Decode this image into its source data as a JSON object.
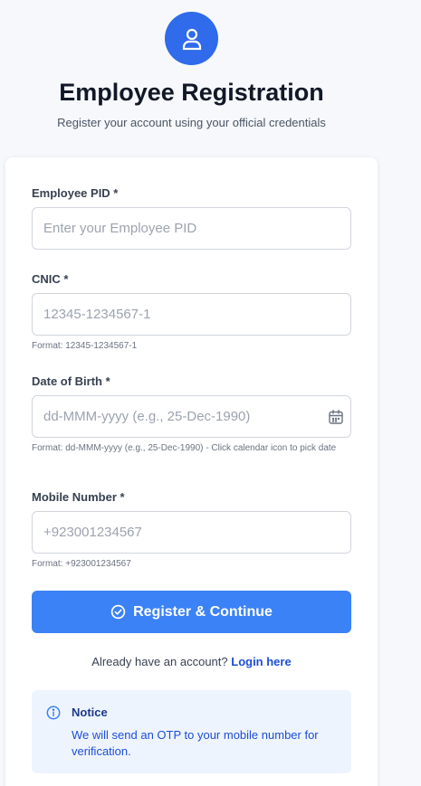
{
  "header": {
    "title": "Employee Registration",
    "subtitle": "Register your account using your official credentials",
    "avatar_icon": "user-icon"
  },
  "form": {
    "pid": {
      "label": "Employee PID *",
      "placeholder": "Enter your Employee PID",
      "value": ""
    },
    "cnic": {
      "label": "CNIC *",
      "placeholder": "12345-1234567-1",
      "hint": "Format: 12345-1234567-1",
      "value": ""
    },
    "dob": {
      "label": "Date of Birth *",
      "placeholder": "dd-MMM-yyyy (e.g., 25-Dec-1990)",
      "hint": "Format: dd-MMM-yyyy (e.g., 25-Dec-1990) - Click calendar icon to pick date",
      "icon": "calendar-icon",
      "value": ""
    },
    "mobile": {
      "label": "Mobile Number *",
      "placeholder": "+923001234567",
      "hint": "Format: +923001234567",
      "value": ""
    },
    "submit_label": "Register & Continue",
    "submit_icon": "check-circle-icon"
  },
  "login": {
    "prompt": "Already have an account?",
    "link_label": "Login here"
  },
  "notice": {
    "icon": "info-icon",
    "title": "Notice",
    "text": "We will send an OTP to your mobile number for verification."
  },
  "colors": {
    "primary": "#3b82f6",
    "avatar": "#2f6bea",
    "link": "#1d4ed8",
    "notice_bg": "#eef4fe"
  }
}
